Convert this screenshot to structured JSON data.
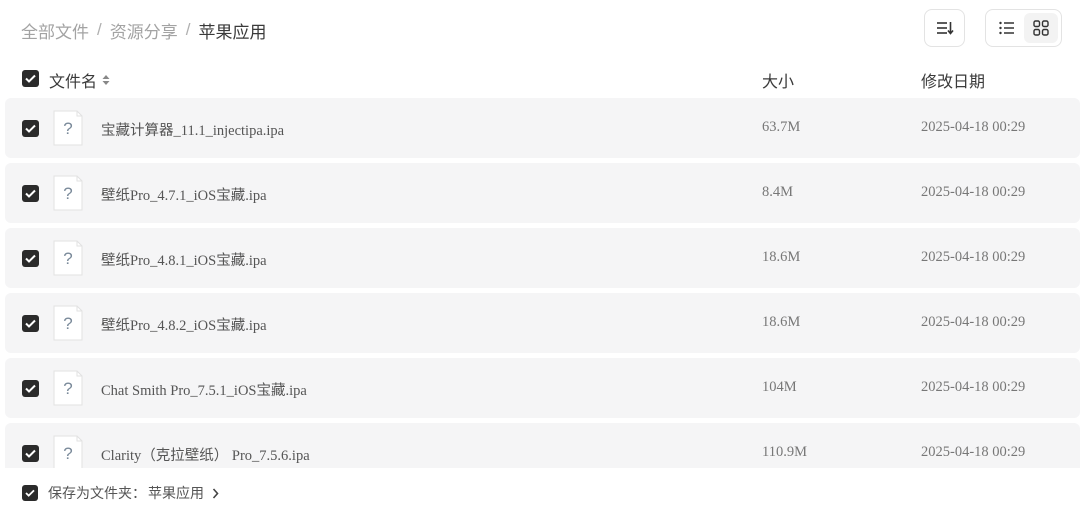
{
  "breadcrumb": {
    "items": [
      "全部文件",
      "资源分享"
    ],
    "separator": "/",
    "current": "苹果应用"
  },
  "toolbar": {
    "sort_icon": "sort-icon",
    "view_list_icon": "list-view-icon",
    "view_grid_icon": "grid-view-icon",
    "active_view": "grid"
  },
  "table": {
    "columns": {
      "name": "文件名",
      "size": "大小",
      "date": "修改日期"
    },
    "rows": [
      {
        "name": "宝藏计算器_11.1_injectipa.ipa",
        "size": "63.7M",
        "date": "2025-04-18 00:29",
        "checked": true,
        "icon": "unknown-file-icon"
      },
      {
        "name": "壁纸Pro_4.7.1_iOS宝藏.ipa",
        "size": "8.4M",
        "date": "2025-04-18 00:29",
        "checked": true,
        "icon": "unknown-file-icon"
      },
      {
        "name": "壁纸Pro_4.8.1_iOS宝藏.ipa",
        "size": "18.6M",
        "date": "2025-04-18 00:29",
        "checked": true,
        "icon": "unknown-file-icon"
      },
      {
        "name": "壁纸Pro_4.8.2_iOS宝藏.ipa",
        "size": "18.6M",
        "date": "2025-04-18 00:29",
        "checked": true,
        "icon": "unknown-file-icon"
      },
      {
        "name": "Chat Smith Pro_7.5.1_iOS宝藏.ipa",
        "size": "104M",
        "date": "2025-04-18 00:29",
        "checked": true,
        "icon": "unknown-file-icon"
      },
      {
        "name": "Clarity（克拉壁纸） Pro_7.5.6.ipa",
        "size": "110.9M",
        "date": "2025-04-18 00:29",
        "checked": true,
        "icon": "unknown-file-icon"
      }
    ]
  },
  "footer": {
    "label": "保存为文件夹：",
    "target": "苹果应用",
    "checked": true
  },
  "colors": {
    "checkbox": "#2b2b2b",
    "row_bg": "#f5f5f6",
    "breadcrumb_muted": "#a3a3a3"
  }
}
